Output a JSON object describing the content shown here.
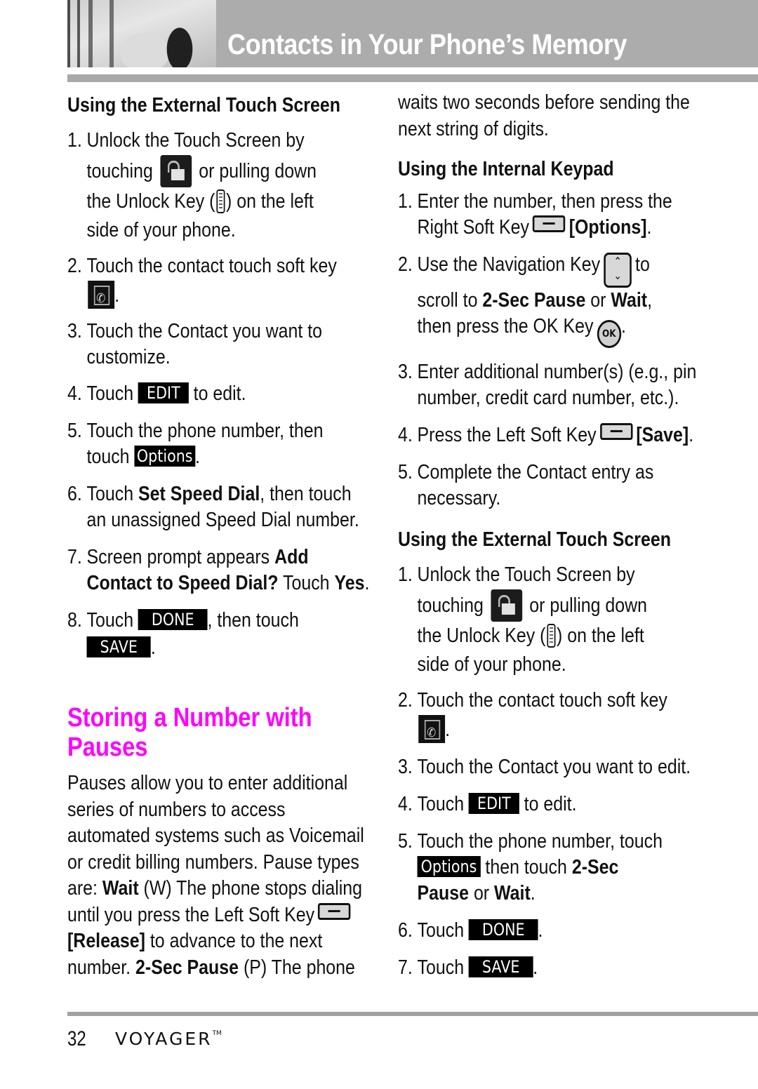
{
  "header": {
    "title": "Contacts in Your Phone’s Memory",
    "photo": "header-photo"
  },
  "left": {
    "subhead": "Using the External Touch Screen",
    "steps": [
      {
        "num": "1.",
        "lines": [
          "Unlock the Touch Screen by",
          "touching",
          "or pulling down",
          "the Unlock Key (",
          ") on the left",
          "side of your phone."
        ]
      },
      {
        "num": "2.",
        "text": "Touch the contact touch soft key",
        "after": "."
      },
      {
        "num": "3.",
        "line1": "Touch the Contact you want to",
        "line2": "customize."
      },
      {
        "num": "4.",
        "before": "Touch",
        "key": "EDIT",
        "after": "to edit."
      },
      {
        "num": "5.",
        "line1": "Touch the phone number, then",
        "before": "touch",
        "key": "Options",
        "after": "."
      },
      {
        "num": "6.",
        "before": "Touch ",
        "bold": "Set Speed Dial",
        "after": ", then touch",
        "line2": "an unassigned Speed Dial number."
      },
      {
        "num": "7.",
        "before": "Screen prompt appears ",
        "bold1": "Add",
        "bold2": "Contact to Speed Dial?",
        "mid": " Touch ",
        "bold3": "Yes",
        "after": "."
      },
      {
        "num": "8.",
        "before": "Touch",
        "key1": "DONE",
        "mid": ", then touch",
        "key2": "SAVE",
        "after": "."
      }
    ],
    "section_title_line1": "Storing a Number with",
    "section_title_line2": "Pauses",
    "para": {
      "l1": "Pauses allow you to enter additional",
      "l2": "series of numbers to access",
      "l3": "automated systems such as Voicemail",
      "l4": "or credit billing numbers. Pause types",
      "l5a": "are: ",
      "l5b": "Wait",
      "l5c": " (W) The phone stops dialing",
      "l6": "until you press the Left Soft Key",
      "l7a": "[Release]",
      "l7b": " to advance to the next",
      "l8a": "number. ",
      "l8b": "2-Sec Pause",
      "l8c": " (P) The phone"
    }
  },
  "right": {
    "cont_l1": "waits two seconds before sending the",
    "cont_l2": "next string of digits.",
    "subhead1": "Using the Internal Keypad",
    "keypad_steps": [
      {
        "num": "1.",
        "line1": "Enter the number, then press the",
        "before": "Right Soft Key",
        "bold": "[Options]",
        "after": "."
      },
      {
        "num": "2.",
        "before": "Use the Navigation Key",
        "after": "to",
        "l2a": "scroll to ",
        "l2b": "2-Sec Pause",
        "l2c": " or ",
        "l2d": "Wait",
        "l2e": ",",
        "l3": "then press the OK Key",
        "l3after": ".",
        "ok_label": "OK"
      },
      {
        "num": "3.",
        "line1": "Enter additional number(s) (e.g., pin",
        "line2": "number, credit card number, etc.)."
      },
      {
        "num": "4.",
        "before": "Press the Left Soft Key",
        "bold": "[Save]",
        "after": "."
      },
      {
        "num": "5.",
        "line1": "Complete the Contact entry as",
        "line2": "necessary."
      }
    ],
    "subhead2": "Using the External Touch Screen",
    "touch_steps": [
      {
        "num": "1.",
        "lines": [
          "Unlock the Touch Screen by",
          "touching",
          "or pulling down",
          "the Unlock Key (",
          ") on the left",
          "side of your phone."
        ]
      },
      {
        "num": "2.",
        "text": "Touch the contact touch soft key",
        "after": "."
      },
      {
        "num": "3.",
        "text": "Touch the Contact you want to edit."
      },
      {
        "num": "4.",
        "before": "Touch",
        "key": "EDIT",
        "after": "to edit."
      },
      {
        "num": "5.",
        "line1": "Touch the phone number, touch",
        "key": "Options",
        "mid": " then touch ",
        "bold1": "2-Sec",
        "bold2": "Pause",
        "or": " or ",
        "bold3": "Wait",
        "after": "."
      },
      {
        "num": "6.",
        "before": "Touch",
        "key": "DONE",
        "after": "."
      },
      {
        "num": "7.",
        "before": "Touch",
        "key": "SAVE",
        "after": "."
      }
    ]
  },
  "footer": {
    "page_number": "32",
    "brand": "VOYAGER",
    "trademark": "TM"
  },
  "colors": {
    "section_title": "#ff00ff",
    "header_band": "#acacac",
    "key_bg": "#000000"
  }
}
